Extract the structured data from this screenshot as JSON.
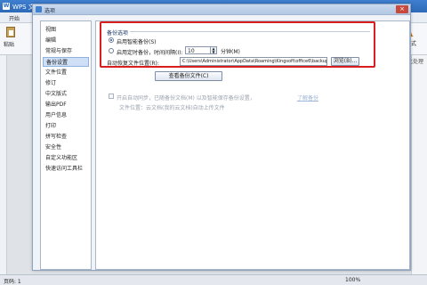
{
  "app": {
    "title": "WPS 文",
    "logo": "W",
    "tab_active": "开始",
    "paste_label": "粘贴",
    "style_label": "新样式",
    "style_icon": "A",
    "extra_label": "健康化处理",
    "status_left": "页码: 1",
    "status_zoom": "100%"
  },
  "dialog": {
    "title": "选项",
    "close": "×",
    "nav": [
      "视图",
      "编辑",
      "常规与保存",
      "备份设置",
      "文件位置",
      "修订",
      "中文版式",
      "输出PDF",
      "用户信息",
      "打印",
      "拼写检查",
      "安全性",
      "自定义功能区",
      "快速访问工具栏"
    ],
    "selected_index": 3,
    "section_title": "备份选项",
    "radio_smart": "启用智能备份(S)",
    "radio_timed": "启用定时备份，时间间隔(I):",
    "interval_value": "10",
    "interval_unit": "分钟(M)",
    "location_label": "自动恢复文件位置(R):",
    "location_path": "C:\\Users\\Administrator\\AppData\\Roaming\\Kingsoft\\office6\\backup",
    "browse_button": "浏览(B)...",
    "view_backup_button": "查看备份文件(C)",
    "checkbox_label": "开启自动同步，已随备份文档(M) 以及智能保存备份设置，",
    "checkbox_link": "了解备份",
    "info_text": "文件位置：云文档(我的云文档)自动上传文件",
    "colors": {
      "highlight": "#d81e1e",
      "title_bar": "#2d6ab8",
      "selected_nav": "#cfe0f6"
    }
  }
}
